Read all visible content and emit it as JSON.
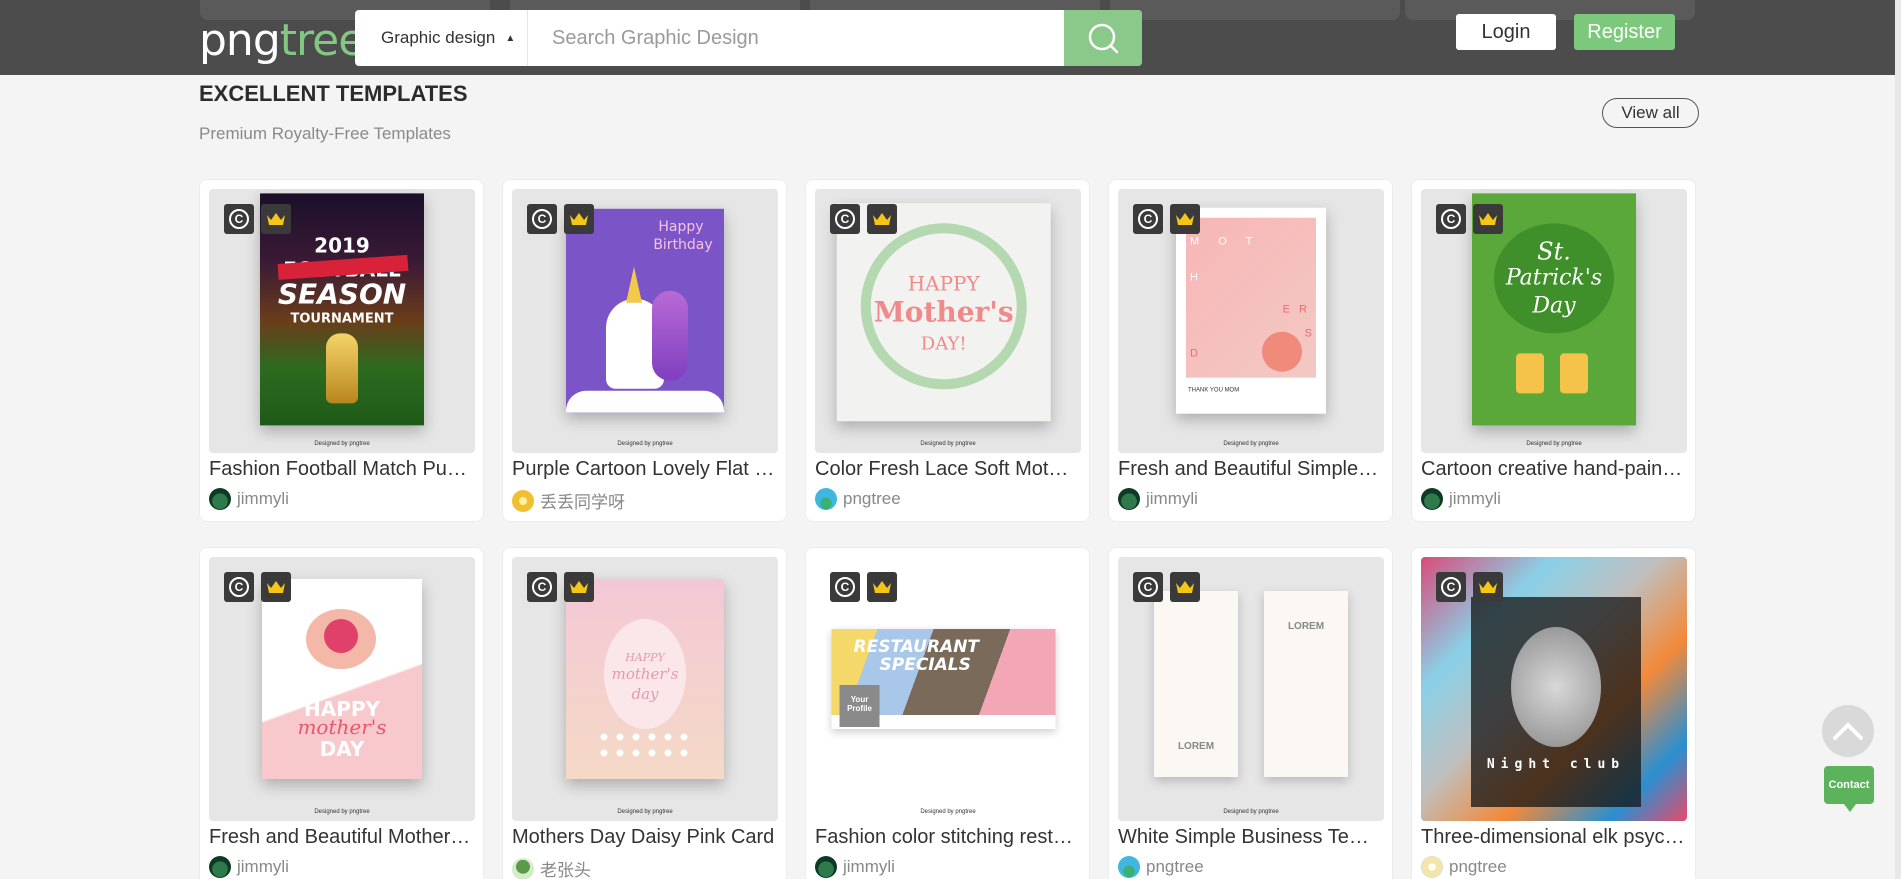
{
  "header": {
    "logo_part1": "png",
    "logo_part2": "tree",
    "search": {
      "category": "Graphic design",
      "placeholder": "Search Graphic Design"
    },
    "login_label": "Login",
    "register_label": "Register"
  },
  "section": {
    "title": "EXCELLENT TEMPLATES",
    "subtitle": "Premium Royalty-Free Templates",
    "view_all": "View all"
  },
  "cards": [
    {
      "title": "Fashion Football Match Pu…",
      "author": "jimmyli",
      "avatar": "green-tree-avatar",
      "poster_text": [
        "2019 FOOTBALL",
        "SEASON",
        "TOURNAMENT"
      ]
    },
    {
      "title": "Purple Cartoon Lovely Flat …",
      "author": "丢丢同学呀",
      "avatar": "yellow-avatar",
      "poster_text": [
        "Happy",
        "Birthday"
      ]
    },
    {
      "title": "Color Fresh Lace Soft Mot…",
      "author": "pngtree",
      "avatar": "pngtree-avatar",
      "poster_text": [
        "HAPPY",
        "Mother's",
        "DAY!"
      ]
    },
    {
      "title": "Fresh and Beautiful Simple…",
      "author": "jimmyli",
      "avatar": "green-tree-avatar",
      "poster_text": [
        "M O T",
        "H",
        "E R",
        "D",
        "S",
        "THANK YOU MOM"
      ]
    },
    {
      "title": "Cartoon creative hand-pain…",
      "author": "jimmyli",
      "avatar": "green-tree-avatar",
      "poster_text": [
        "St.",
        "Patrick's",
        "Day"
      ]
    },
    {
      "title": "Fresh and Beautiful Mother…",
      "author": "jimmyli",
      "avatar": "green-tree-avatar",
      "poster_text": [
        "HAPPY",
        "mother's",
        "DAY"
      ]
    },
    {
      "title": "Mothers Day Daisy Pink Card",
      "author": "老张头",
      "avatar": "tree-avatar",
      "poster_text": [
        "HAPPY",
        "mother's",
        "day"
      ]
    },
    {
      "title": "Fashion color stitching rest…",
      "author": "jimmyli",
      "avatar": "green-tree-avatar",
      "poster_text": [
        "RESTAURANT",
        "SPECIALS",
        "Your Profile"
      ]
    },
    {
      "title": "White Simple Business Te…",
      "author": "pngtree",
      "avatar": "pngtree-avatar",
      "poster_text": [
        "LOREM",
        "LOREM"
      ]
    },
    {
      "title": "Three-dimensional elk psyc…",
      "author": "pngtree",
      "avatar": "light-avatar",
      "poster_text": [
        "Night club"
      ]
    }
  ],
  "designed_by": "Designed by pngtree",
  "floating": {
    "contact_label": "Contact"
  },
  "colors": {
    "header_bg": "#4c4c4c",
    "brand_green": "#7cc87c",
    "page_bg": "#f4f4f4"
  }
}
